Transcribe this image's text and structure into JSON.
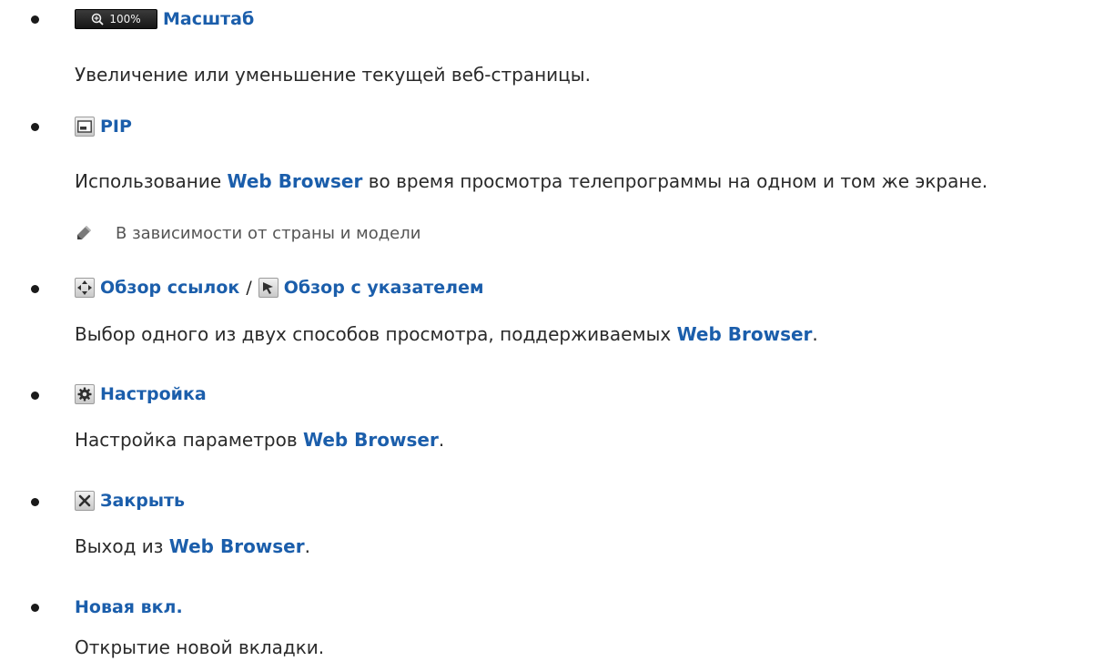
{
  "items": [
    {
      "icon": "zoom-icon",
      "icon_text": "100%",
      "title": "Масштаб",
      "description": "Увеличение или уменьшение текущей веб-страницы."
    },
    {
      "icon": "pip-icon",
      "title": "PIP",
      "description_before": "Использование ",
      "description_highlight": "Web Browser",
      "description_after": " во время просмотра телепрограммы на одном и том же экране.",
      "note": {
        "icon": "pencil-icon",
        "text": "В зависимости от страны и модели"
      }
    },
    {
      "icon": "link-browse-icon",
      "title": "Обзор ссылок",
      "separator": "/",
      "icon2": "pointer-browse-icon",
      "title2": "Обзор с указателем",
      "description_before": "Выбор одного из двух способов просмотра, поддерживаемых ",
      "description_highlight": "Web Browser",
      "description_after": "."
    },
    {
      "icon": "gear-icon",
      "title": "Настройка",
      "description_before": "Настройка параметров ",
      "description_highlight": "Web Browser",
      "description_after": "."
    },
    {
      "icon": "close-icon",
      "title": "Закрыть",
      "description_before": "Выход из ",
      "description_highlight": "Web Browser",
      "description_after": "."
    },
    {
      "title": "Новая вкл.",
      "description": "Открытие новой вкладки."
    }
  ],
  "colors": {
    "link": "#1b5eab",
    "text": "#2a2a2a",
    "note": "#555555"
  }
}
